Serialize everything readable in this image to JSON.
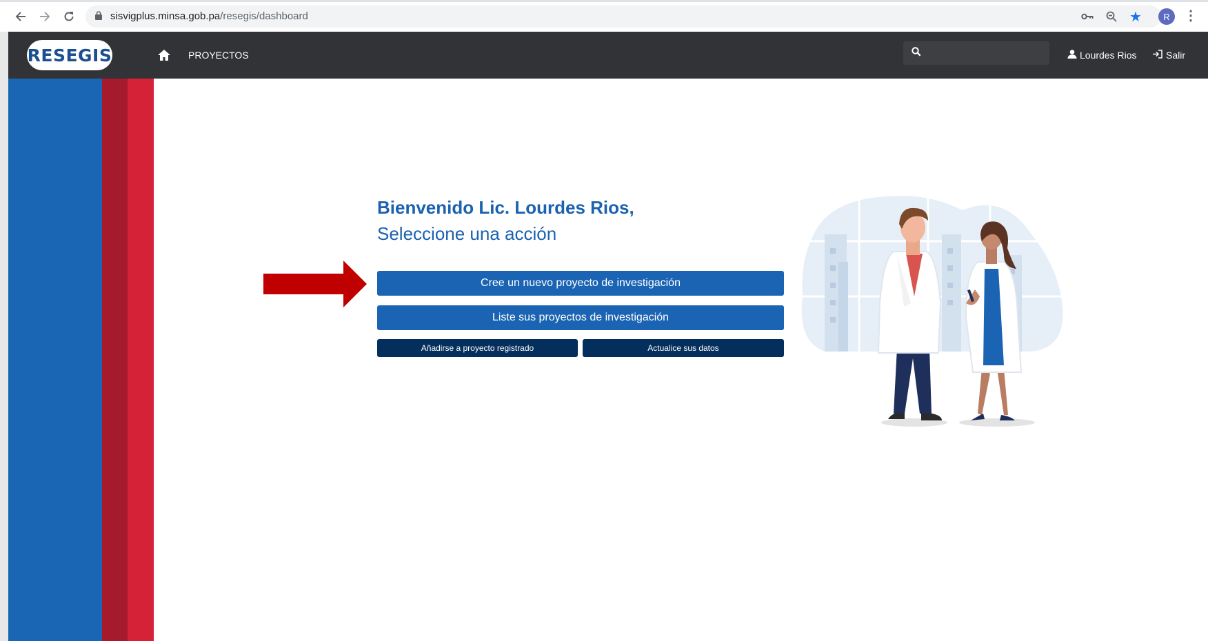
{
  "browser": {
    "url_domain": "sisvigplus.minsa.gob.pa",
    "url_path": "/resegis/dashboard",
    "profile_initial": "R"
  },
  "navbar": {
    "logo_text": "RESEGIS",
    "proyectos_label": "PROYECTOS",
    "search_value": "",
    "user_name": "Lourdes Rios",
    "logout_label": "Salir"
  },
  "main": {
    "greeting_line1": "Bienvenido Lic. Lourdes Rios,",
    "greeting_line2": "Seleccione una acción",
    "btn_new_project": "Cree un nuevo proyecto de investigación",
    "btn_list_projects": "Liste sus proyectos de investigación",
    "btn_join_project": "Añadirse a proyecto registrado",
    "btn_update_data": "Actualice sus datos"
  },
  "colors": {
    "stripe_blue": "#1a66b4",
    "stripe_dark_red": "#a51a2d",
    "stripe_red": "#d52237",
    "primary_button": "#1b64b3",
    "dark_button": "#042f5c",
    "annotation_arrow": "#c00000"
  },
  "icons": [
    "back-icon",
    "forward-icon",
    "reload-icon",
    "lock-icon",
    "key-icon",
    "zoom-icon",
    "star-icon",
    "home-icon",
    "search-icon",
    "user-icon",
    "logout-icon",
    "red-arrow-annotation",
    "doctors-illustration"
  ]
}
